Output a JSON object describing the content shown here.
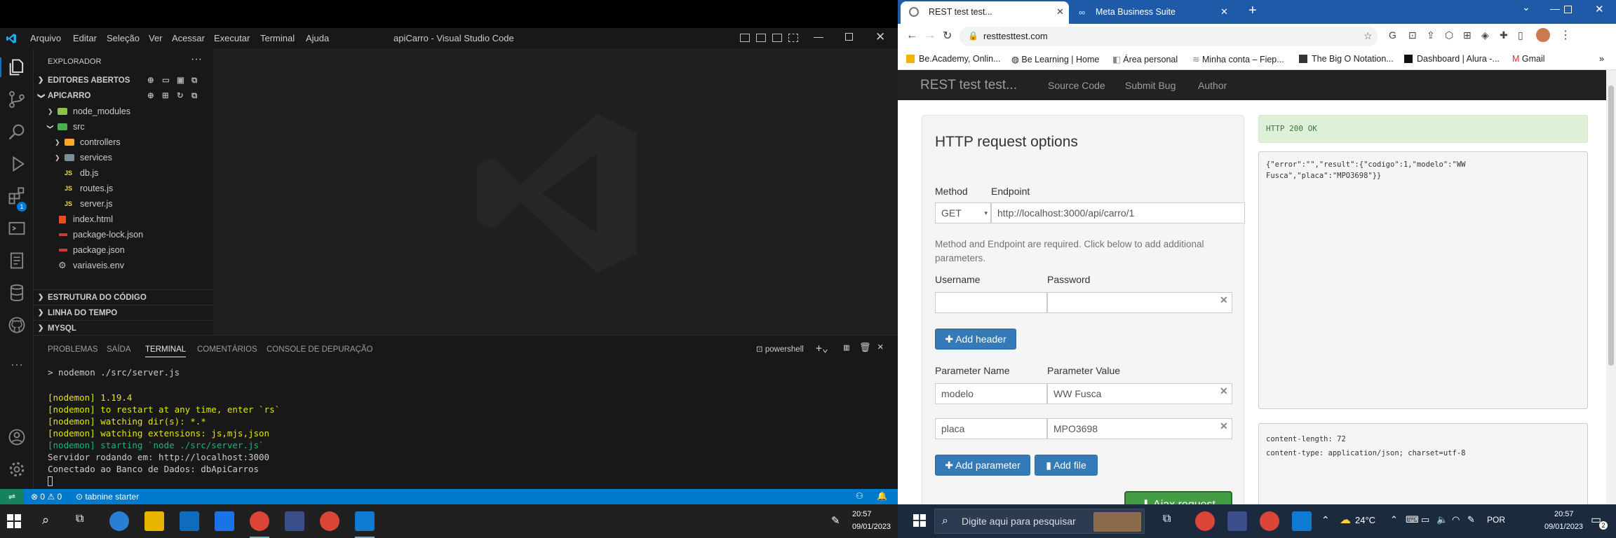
{
  "vscode": {
    "title": "apiCarro - Visual Studio Code",
    "menu": [
      "Arquivo",
      "Editar",
      "Seleção",
      "Ver",
      "Acessar",
      "Executar",
      "Terminal",
      "Ajuda"
    ],
    "explorer_title": "EXPLORADOR",
    "open_editors": "EDITORES ABERTOS",
    "project": "APICARRO",
    "tree": [
      {
        "label": "node_modules",
        "icon": "folder-icon"
      },
      {
        "label": "src",
        "icon": "folder-open-icon"
      },
      {
        "label": "controllers",
        "icon": "folder-icon"
      },
      {
        "label": "services",
        "icon": "folder-icon"
      },
      {
        "label": "db.js",
        "icon": "js-icon"
      },
      {
        "label": "routes.js",
        "icon": "js-icon"
      },
      {
        "label": "server.js",
        "icon": "js-icon"
      },
      {
        "label": "index.html",
        "icon": "html-icon"
      },
      {
        "label": "package-lock.json",
        "icon": "json-icon"
      },
      {
        "label": "package.json",
        "icon": "json-icon"
      },
      {
        "label": "variaveis.env",
        "icon": "gear-icon"
      }
    ],
    "js_badge": "JS",
    "bottom_sections": [
      "ESTRUTURA DO CÓDIGO",
      "LINHA DO TEMPO",
      "MYSQL"
    ],
    "panel_tabs": [
      "PROBLEMAS",
      "SAÍDA",
      "TERMINAL",
      "COMENTÁRIOS",
      "CONSOLE DE DEPURAÇÃO"
    ],
    "shell": "powershell",
    "terminal": {
      "command": "> nodemon ./src/server.js",
      "lines": [
        "[nodemon] 1.19.4",
        "[nodemon] to restart at any time, enter `rs`",
        "[nodemon] watching dir(s): *.*",
        "[nodemon] watching extensions: js,mjs,json",
        "[nodemon] starting `node ./src/server.js`"
      ],
      "output": [
        "Servidor rodando em: http://localhost:3000",
        "Conectado ao Banco de Dados: dbApiCarros"
      ]
    },
    "status": {
      "errors": "0",
      "warnings": "0",
      "tabnine": "tabnine starter"
    },
    "badge": "1"
  },
  "chrome": {
    "tabs": [
      {
        "title": "REST test test..."
      },
      {
        "title": "Meta Business Suite"
      }
    ],
    "url": "resttesttest.com",
    "bookmarks": [
      "Be.Academy, Onlin...",
      "Be Learning | Home",
      "Área personal",
      "Minha conta – Fiep...",
      "The Big O Notation...",
      "Dashboard | Alura -...",
      "Gmail"
    ],
    "site": {
      "brand": "REST test test...",
      "nav": [
        "Source Code",
        "Submit Bug",
        "Author"
      ],
      "heading": "HTTP request options",
      "method_label": "Method",
      "endpoint_label": "Endpoint",
      "method": "GET",
      "endpoint": "http://localhost:3000/api/carro/1",
      "help": "Method and Endpoint are required. Click below to add additional parameters.",
      "username_label": "Username",
      "password_label": "Password",
      "add_header": "Add header",
      "param_name_label": "Parameter Name",
      "param_value_label": "Parameter Value",
      "params": [
        {
          "name": "modelo",
          "value": "WW Fusca"
        },
        {
          "name": "placa",
          "value": "MPO3698"
        }
      ],
      "add_parameter": "Add parameter",
      "add_file": "Add file",
      "ajax": "Ajax request",
      "status": "HTTP 200 OK",
      "response_body": "{\"error\":\"\",\"result\":{\"codigo\":1,\"modelo\":\"WW Fusca\",\"placa\":\"MPO3698\"}}",
      "response_headers": [
        "content-length: 72",
        "content-type: application/json; charset=utf-8"
      ]
    }
  },
  "taskbar": {
    "search_placeholder": "Digite aqui para pesquisar",
    "weather": "24°C",
    "lang": "POR",
    "time": "20:57",
    "date": "09/01/2023",
    "badge": "2"
  },
  "colors": {
    "vs_status": "#007acc",
    "bootstrap_primary": "#337ab7",
    "success": "#3c763d",
    "chrome_tab": "#1e5aa8"
  }
}
